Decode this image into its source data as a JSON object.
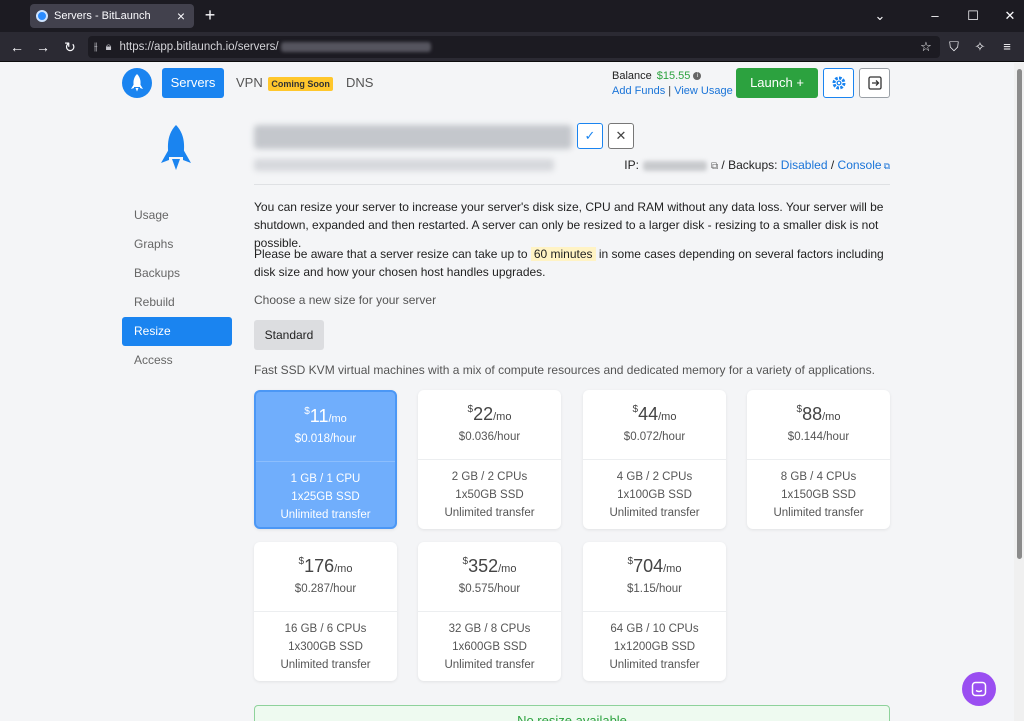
{
  "browser": {
    "tab_title": "Servers - BitLaunch",
    "url_prefix": "https://app.bitlaunch.io/servers/",
    "icons": [
      "back-icon",
      "forward-icon",
      "reload-icon",
      "tracking-icon",
      "lock-icon",
      "star-icon",
      "shield-icon",
      "extension-icon",
      "menu-icon"
    ]
  },
  "topnav": {
    "servers": "Servers",
    "vpn": "VPN",
    "coming_soon": "Coming Soon",
    "dns": "DNS",
    "balance_label": "Balance",
    "balance_amount": "$15.55",
    "add_funds": "Add Funds",
    "separator": "|",
    "view_usage": "View Usage",
    "launch": "Launch +"
  },
  "server": {
    "ip_label": "IP:",
    "backups_label": "/ Backups:",
    "backups_status": "Disabled",
    "slash": "/",
    "console": "Console"
  },
  "sidemenu": [
    {
      "label": "Usage",
      "active": false
    },
    {
      "label": "Graphs",
      "active": false
    },
    {
      "label": "Backups",
      "active": false
    },
    {
      "label": "Rebuild",
      "active": false
    },
    {
      "label": "Resize",
      "active": true
    },
    {
      "label": "Access",
      "active": false
    }
  ],
  "content": {
    "para1": "You can resize your server to increase your server's disk size, CPU and RAM without any data loss. Your server will be shutdown, expanded and then restarted. A server can only be resized to a larger disk - resizing to a smaller disk is not possible.",
    "para2_before": "Please be aware that a server resize can take up to ",
    "para2_highlight": "60 minutes",
    "para2_after": " in some cases depending on several factors including disk size and how your chosen host handles upgrades.",
    "choose": "Choose a new size for your server",
    "standard": "Standard",
    "ssd_desc": "Fast SSD KVM virtual machines with a mix of compute resources and dedicated memory for a variety of applications.",
    "no_resize": "No resize available"
  },
  "plans": [
    {
      "currency": "$",
      "price": "11",
      "per": "/mo",
      "hourly": "$0.018/hour",
      "ram_cpu": "1 GB / 1 CPU",
      "disk": "1x25GB SSD",
      "transfer": "Unlimited transfer",
      "selected": true
    },
    {
      "currency": "$",
      "price": "22",
      "per": "/mo",
      "hourly": "$0.036/hour",
      "ram_cpu": "2 GB / 2 CPUs",
      "disk": "1x50GB SSD",
      "transfer": "Unlimited transfer",
      "selected": false
    },
    {
      "currency": "$",
      "price": "44",
      "per": "/mo",
      "hourly": "$0.072/hour",
      "ram_cpu": "4 GB / 2 CPUs",
      "disk": "1x100GB SSD",
      "transfer": "Unlimited transfer",
      "selected": false
    },
    {
      "currency": "$",
      "price": "88",
      "per": "/mo",
      "hourly": "$0.144/hour",
      "ram_cpu": "8 GB / 4 CPUs",
      "disk": "1x150GB SSD",
      "transfer": "Unlimited transfer",
      "selected": false
    },
    {
      "currency": "$",
      "price": "176",
      "per": "/mo",
      "hourly": "$0.287/hour",
      "ram_cpu": "16 GB / 6 CPUs",
      "disk": "1x300GB SSD",
      "transfer": "Unlimited transfer",
      "selected": false
    },
    {
      "currency": "$",
      "price": "352",
      "per": "/mo",
      "hourly": "$0.575/hour",
      "ram_cpu": "32 GB / 8 CPUs",
      "disk": "1x600GB SSD",
      "transfer": "Unlimited transfer",
      "selected": false
    },
    {
      "currency": "$",
      "price": "704",
      "per": "/mo",
      "hourly": "$1.15/hour",
      "ram_cpu": "64 GB / 10 CPUs",
      "disk": "1x1200GB SSD",
      "transfer": "Unlimited transfer",
      "selected": false
    }
  ],
  "colors": {
    "accent": "#1a84f0",
    "launch": "#2ca23f",
    "selected_plan": "#70aefc",
    "chat": "#9a4ef1"
  }
}
